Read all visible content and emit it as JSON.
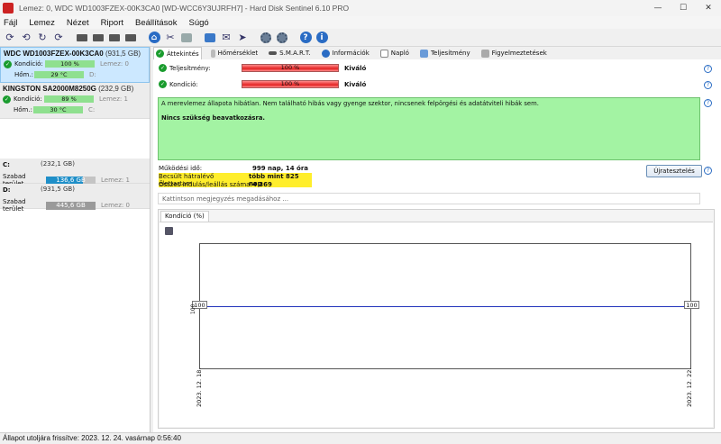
{
  "window": {
    "title": "Lemez: 0, WDC WD1003FZEX-00K3CA0 [WD-WCC6Y3UJRFH7]  -  Hard Disk Sentinel 6.10 PRO",
    "minimize": "—",
    "maximize": "☐",
    "close": "✕"
  },
  "menu": [
    "Fájl",
    "Lemez",
    "Nézet",
    "Riport",
    "Beállítások",
    "Súgó"
  ],
  "disks": [
    {
      "name": "WDC WD1003FZEX-00K3CA0",
      "size": "(931,5 GB)",
      "health_label": "Kondíció:",
      "health": "100 %",
      "health_pct": 100,
      "disk_ref": "Lemez: 0",
      "temp_label": "Hőm.:",
      "temp": "29 °C",
      "drive": "D:"
    },
    {
      "name": "KINGSTON SA2000M8250G",
      "size": "(232,9 GB)",
      "health_label": "Kondíció:",
      "health": "89 %",
      "health_pct": 89,
      "disk_ref": "Lemez: 1",
      "temp_label": "Hőm.:",
      "temp": "30 °C",
      "drive": "C:"
    }
  ],
  "volumes": [
    {
      "letter": "C:",
      "size": "(232,1 GB)",
      "free_label": "Szabad terület",
      "free": "136,6 GB",
      "disk_ref": "Lemez: 1"
    },
    {
      "letter": "D:",
      "size": "(931,5 GB)",
      "free_label": "Szabad terület",
      "free": "445,6 GB",
      "disk_ref": "Lemez: 0"
    }
  ],
  "tabs": [
    "Áttekintés",
    "Hőmérséklet",
    "S.M.A.R.T.",
    "Információk",
    "Napló",
    "Teljesítmény",
    "Figyelmeztetések"
  ],
  "performance": {
    "label": "Teljesítmény:",
    "bar": "100 %",
    "value": "Kiváló",
    "pct": 100
  },
  "health": {
    "label": "Kondíció:",
    "bar": "100 %",
    "value": "Kiváló",
    "pct": 100
  },
  "status": {
    "message": "A merevlemez állapota hibátlan. Nem található hibás vagy gyenge szektor, nincsenek felpörgési és adatátviteli hibák sem.",
    "action": "Nincs szükség beavatkozásra."
  },
  "info": [
    {
      "label": "Működési idő:",
      "value": "999 nap, 14 óra"
    },
    {
      "label": "Becsült hátralévő élettartam:",
      "value": "több mint 825 nap"
    },
    {
      "label": "Összes indulás/leállás száma:",
      "value": "4 369"
    }
  ],
  "retest_label": "Újratesztelés",
  "note_placeholder": "Kattintson megjegyzés megadásához ...",
  "chart_data": {
    "type": "line",
    "tab": "Kondíció  (%)",
    "x": [
      "2023. 12. 18.",
      "2023. 12. 22."
    ],
    "series": [
      {
        "values": [
          100,
          100
        ]
      }
    ],
    "ylabel": "100",
    "ylim": [
      0,
      100
    ],
    "start_tag": "100",
    "end_tag": "100"
  },
  "statusbar": "Állapot utoljára frissítve: 2023. 12. 24. vasárnap 0:56:40"
}
